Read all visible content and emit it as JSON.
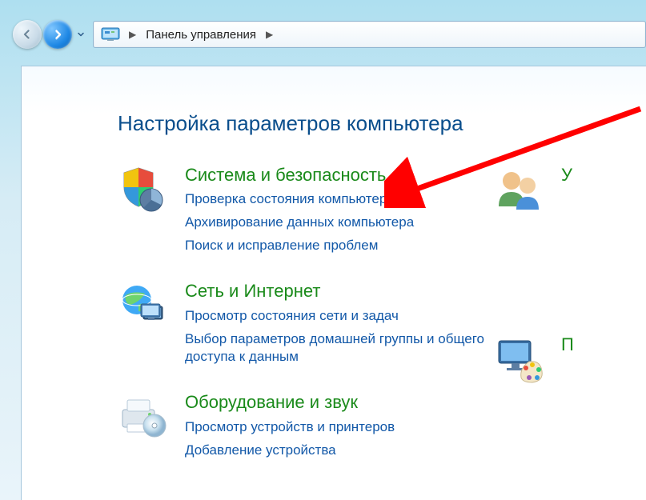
{
  "breadcrumb": {
    "root": "Панель управления"
  },
  "title": "Настройка параметров компьютера",
  "categories": {
    "system": {
      "title": "Система и безопасность",
      "links": [
        "Проверка состояния компьютера",
        "Архивирование данных компьютера",
        "Поиск и исправление проблем"
      ]
    },
    "network": {
      "title": "Сеть и Интернет",
      "links": [
        "Просмотр состояния сети и задач",
        "Выбор параметров домашней группы и общего доступа к данным"
      ]
    },
    "hardware": {
      "title": "Оборудование и звук",
      "links": [
        "Просмотр устройств и принтеров",
        "Добавление устройства"
      ]
    },
    "users_partial": {
      "title": "У"
    },
    "appearance_partial": {
      "title": "П"
    }
  }
}
